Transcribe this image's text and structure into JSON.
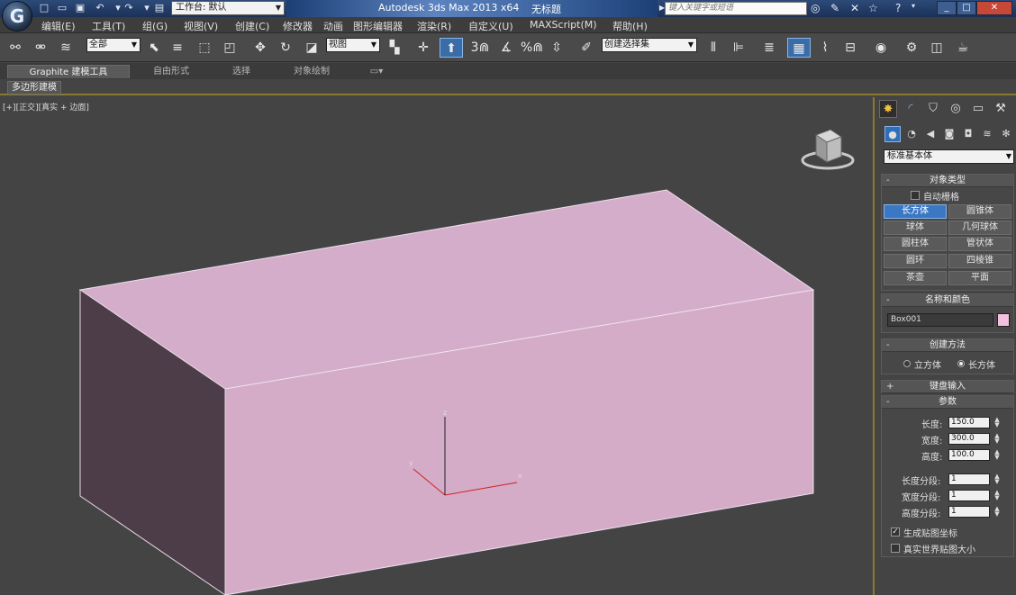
{
  "titlebar": {
    "app_logo": "G",
    "workspace_value": "工作台: 默认",
    "app_title": "Autodesk 3ds Max  2013 x64",
    "doc_title": "无标题",
    "search_placeholder": "键入关键字或短语"
  },
  "menu": [
    "编辑(E)",
    "工具(T)",
    "组(G)",
    "视图(V)",
    "创建(C)",
    "修改器",
    "动画",
    "图形编辑器",
    "渲染(R)",
    "自定义(U)",
    "MAXScript(M)",
    "帮助(H)"
  ],
  "toolbar": {
    "selection_filter": "全部",
    "ref_coord": "视图",
    "snap_3": "3",
    "snap_percent": "%",
    "named_selection": "创建选择集"
  },
  "ribbon": {
    "tabs": [
      "Graphite 建模工具",
      "自由形式",
      "选择",
      "对象绘制"
    ],
    "panel": "多边形建模"
  },
  "viewport": {
    "label_plus": "[+]",
    "label_view": "[正交]",
    "label_shading": "[真实 + 边面]",
    "object_color": "#d4aac8",
    "object_side_color": "#4d3d48",
    "axis_x": "x",
    "axis_y": "y",
    "axis_z": "z"
  },
  "command_panel": {
    "category": "标准基本体",
    "object_type": {
      "title": "对象类型",
      "autogrid_label": "自动栅格",
      "buttons": [
        "长方体",
        "圆锥体",
        "球体",
        "几何球体",
        "圆柱体",
        "管状体",
        "圆环",
        "四棱锥",
        "茶壶",
        "平面"
      ],
      "active": "长方体"
    },
    "name_color": {
      "title": "名称和颜色",
      "name": "Box001",
      "swatch": "#f5c0e0"
    },
    "creation_method": {
      "title": "创建方法",
      "options": [
        "立方体",
        "长方体"
      ],
      "selected": "长方体"
    },
    "keyboard_entry": {
      "title": "键盘输入"
    },
    "parameters": {
      "title": "参数",
      "length_label": "长度:",
      "length": "150.0",
      "width_label": "宽度:",
      "width": "300.0",
      "height_label": "高度:",
      "height": "100.0",
      "length_segs_label": "长度分段:",
      "length_segs": "1",
      "width_segs_label": "宽度分段:",
      "width_segs": "1",
      "height_segs_label": "高度分段:",
      "height_segs": "1",
      "gen_mapping_label": "生成贴图坐标",
      "real_world_label": "真实世界贴图大小"
    }
  }
}
